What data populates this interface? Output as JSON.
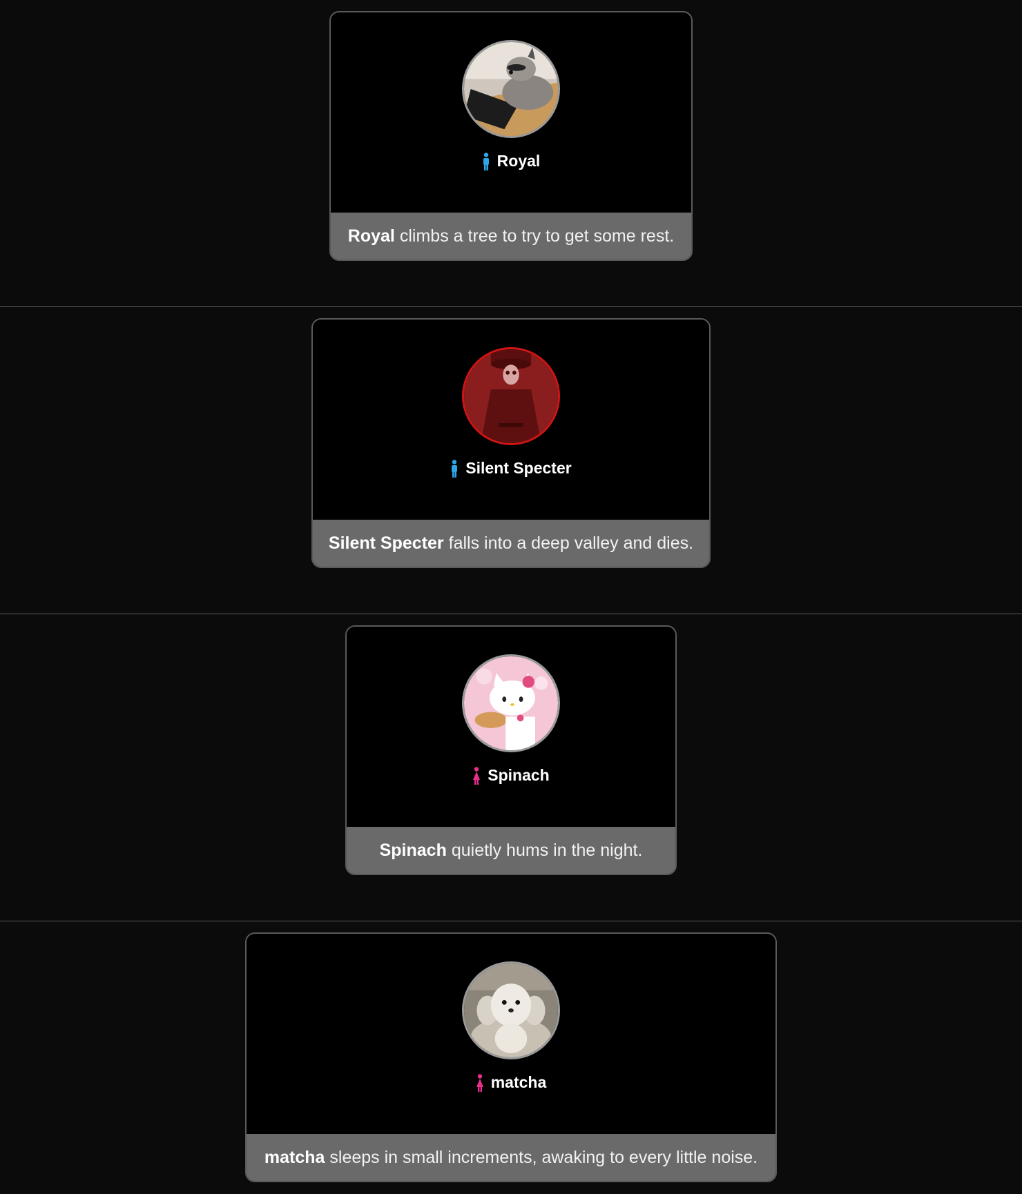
{
  "events": [
    {
      "name": "Royal",
      "gender": "male",
      "avatar": "raccoon-at-keyboard",
      "action": "climbs a tree to try to get some rest."
    },
    {
      "name": "Silent Specter",
      "gender": "male",
      "avatar": "red-tinted-ghost-figure",
      "action": "falls into a deep valley and dies."
    },
    {
      "name": "Spinach",
      "gender": "female",
      "avatar": "hello-kitty-with-pie",
      "action": "quietly hums in the night."
    },
    {
      "name": "matcha",
      "gender": "female",
      "avatar": "white-puppy",
      "action": "sleeps in small increments, awaking to every little noise."
    }
  ],
  "colors": {
    "male_icon": "#2ea6e8",
    "female_icon": "#e8308a",
    "dead_border": "#d01515",
    "caption_bg": "#6a6a6a"
  }
}
